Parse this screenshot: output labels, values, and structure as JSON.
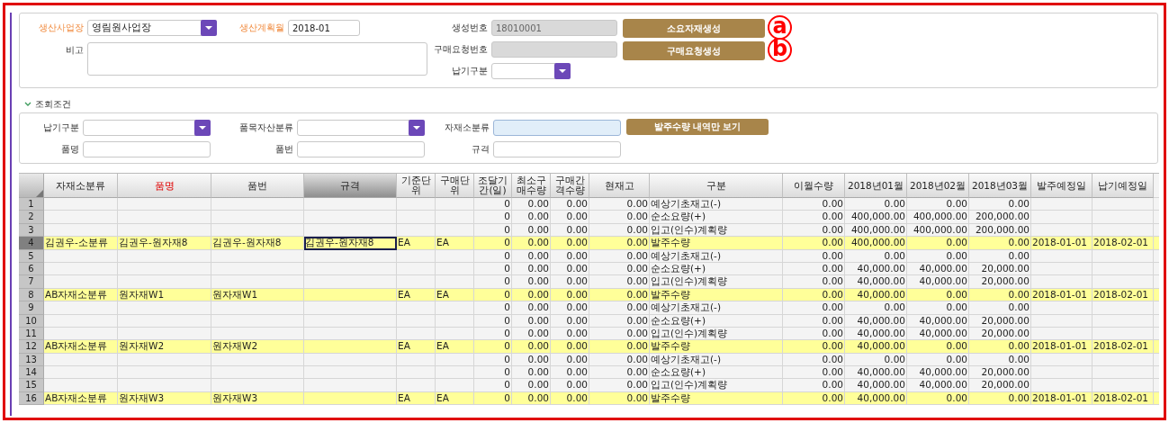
{
  "form": {
    "left_rows": [
      [
        {
          "label": "생산사업장",
          "required": true,
          "kind": "select",
          "value": "영림원사업장"
        },
        {
          "label": "생산계획월",
          "required": true,
          "kind": "text",
          "value": "2018-01"
        }
      ],
      [
        {
          "label": "비고",
          "required": false,
          "kind": "textarea"
        }
      ]
    ],
    "middle": [
      {
        "label": "생성번호",
        "kind": "text",
        "disabled": true,
        "value": "18010001"
      },
      {
        "label": "구매요청번호",
        "kind": "text",
        "disabled": true
      },
      {
        "label": "납기구분",
        "kind": "select"
      }
    ],
    "buttons": [
      {
        "label": "소요자재생성",
        "marker": "a"
      },
      {
        "label": "구매요청생성",
        "marker": "b"
      }
    ]
  },
  "search": {
    "title": "조회조건",
    "expanded": true,
    "fields": [
      {
        "label": "납기구분",
        "kind": "select",
        "active": false
      },
      {
        "label": "품목자산분류",
        "kind": "select",
        "active": false
      },
      {
        "label": "자재소분류",
        "kind": "text",
        "active": true
      },
      {
        "label": "품명",
        "kind": "text",
        "active": false
      },
      {
        "label": "품번",
        "kind": "text",
        "active": false
      },
      {
        "label": "규격",
        "kind": "text",
        "active": false
      }
    ],
    "button": "발주수량 내역만 보기"
  },
  "table": {
    "columns": [
      {
        "label": "자재소분류",
        "kind": "text",
        "required": false,
        "selected": false
      },
      {
        "label": "품명",
        "kind": "text",
        "required": true,
        "selected": false
      },
      {
        "label": "품번",
        "kind": "text",
        "required": false,
        "selected": false
      },
      {
        "label": "규격",
        "kind": "text",
        "required": false,
        "selected": true
      },
      {
        "label": "기준단위",
        "kind": "text",
        "required": false,
        "selected": false
      },
      {
        "label": "구매단위",
        "kind": "text",
        "required": false,
        "selected": false
      },
      {
        "label": "조달기간(일)",
        "kind": "number",
        "required": false,
        "selected": false
      },
      {
        "label": "최소구매수량",
        "kind": "number",
        "required": false,
        "selected": false
      },
      {
        "label": "구매간격수량",
        "kind": "number",
        "required": false,
        "selected": false
      },
      {
        "label": "현재고",
        "kind": "number",
        "required": false,
        "selected": false
      },
      {
        "label": "구분",
        "kind": "text",
        "required": false,
        "selected": false
      },
      {
        "label": "이월수량",
        "kind": "number",
        "required": false,
        "selected": false
      },
      {
        "label": "2018년01월",
        "kind": "number",
        "required": false,
        "selected": false
      },
      {
        "label": "2018년02월",
        "kind": "number",
        "required": false,
        "selected": false
      },
      {
        "label": "2018년03월",
        "kind": "number",
        "required": false,
        "selected": false
      },
      {
        "label": "발주예정일",
        "kind": "text",
        "required": false,
        "selected": false
      },
      {
        "label": "납기예정일",
        "kind": "text",
        "required": false,
        "selected": false
      }
    ],
    "rows": [
      {
        "number": "1",
        "kind": "plan",
        "selected": false,
        "cells": [
          null,
          null,
          null,
          null,
          null,
          null,
          "0",
          "0.00",
          "0.00",
          "0.00",
          "예상기초재고(-)",
          "0.00",
          "0.00",
          "0.00",
          "0.00",
          null,
          null
        ]
      },
      {
        "number": "2",
        "kind": "plan",
        "selected": false,
        "cells": [
          null,
          null,
          null,
          null,
          null,
          null,
          "0",
          "0.00",
          "0.00",
          "0.00",
          "순소요량(+)",
          "0.00",
          "400,000.00",
          "400,000.00",
          "200,000.00",
          null,
          null
        ]
      },
      {
        "number": "3",
        "kind": "plan",
        "selected": false,
        "cells": [
          null,
          null,
          null,
          null,
          null,
          null,
          "0",
          "0.00",
          "0.00",
          "0.00",
          "입고(인수)계획량",
          "0.00",
          "400,000.00",
          "400,000.00",
          "200,000.00",
          null,
          null
        ]
      },
      {
        "number": "4",
        "kind": "order",
        "selected": true,
        "cells": [
          "김권우-소분류",
          "김권우-원자재8",
          "김권우-원자재8",
          "김권우-원자재8",
          "EA",
          "EA",
          "0",
          "0.00",
          "0.00",
          "0.00",
          "발주수량",
          "0.00",
          "400,000.00",
          "0.00",
          "0.00",
          "2018-01-01",
          "2018-02-01"
        ]
      },
      {
        "number": "5",
        "kind": "plan",
        "selected": false,
        "cells": [
          null,
          null,
          null,
          null,
          null,
          null,
          "0",
          "0.00",
          "0.00",
          "0.00",
          "예상기초재고(-)",
          "0.00",
          "0.00",
          "0.00",
          "0.00",
          null,
          null
        ]
      },
      {
        "number": "6",
        "kind": "plan",
        "selected": false,
        "cells": [
          null,
          null,
          null,
          null,
          null,
          null,
          "0",
          "0.00",
          "0.00",
          "0.00",
          "순소요량(+)",
          "0.00",
          "40,000.00",
          "40,000.00",
          "20,000.00",
          null,
          null
        ]
      },
      {
        "number": "7",
        "kind": "plan",
        "selected": false,
        "cells": [
          null,
          null,
          null,
          null,
          null,
          null,
          "0",
          "0.00",
          "0.00",
          "0.00",
          "입고(인수)계획량",
          "0.00",
          "40,000.00",
          "40,000.00",
          "20,000.00",
          null,
          null
        ]
      },
      {
        "number": "8",
        "kind": "order",
        "selected": false,
        "cells": [
          "AB자재소분류",
          "원자재W1",
          "원자재W1",
          null,
          "EA",
          "EA",
          "0",
          "0.00",
          "0.00",
          "0.00",
          "발주수량",
          "0.00",
          "40,000.00",
          "0.00",
          "0.00",
          "2018-01-01",
          "2018-02-01"
        ]
      },
      {
        "number": "9",
        "kind": "plan",
        "selected": false,
        "cells": [
          null,
          null,
          null,
          null,
          null,
          null,
          "0",
          "0.00",
          "0.00",
          "0.00",
          "예상기초재고(-)",
          "0.00",
          "0.00",
          "0.00",
          "0.00",
          null,
          null
        ]
      },
      {
        "number": "10",
        "kind": "plan",
        "selected": false,
        "cells": [
          null,
          null,
          null,
          null,
          null,
          null,
          "0",
          "0.00",
          "0.00",
          "0.00",
          "순소요량(+)",
          "0.00",
          "40,000.00",
          "40,000.00",
          "20,000.00",
          null,
          null
        ]
      },
      {
        "number": "11",
        "kind": "plan",
        "selected": false,
        "cells": [
          null,
          null,
          null,
          null,
          null,
          null,
          "0",
          "0.00",
          "0.00",
          "0.00",
          "입고(인수)계획량",
          "0.00",
          "40,000.00",
          "40,000.00",
          "20,000.00",
          null,
          null
        ]
      },
      {
        "number": "12",
        "kind": "order",
        "selected": false,
        "cells": [
          "AB자재소분류",
          "원자재W2",
          "원자재W2",
          null,
          "EA",
          "EA",
          "0",
          "0.00",
          "0.00",
          "0.00",
          "발주수량",
          "0.00",
          "40,000.00",
          "0.00",
          "0.00",
          "2018-01-01",
          "2018-02-01"
        ]
      },
      {
        "number": "13",
        "kind": "plan",
        "selected": false,
        "cells": [
          null,
          null,
          null,
          null,
          null,
          null,
          "0",
          "0.00",
          "0.00",
          "0.00",
          "예상기초재고(-)",
          "0.00",
          "0.00",
          "0.00",
          "0.00",
          null,
          null
        ]
      },
      {
        "number": "14",
        "kind": "plan",
        "selected": false,
        "cells": [
          null,
          null,
          null,
          null,
          null,
          null,
          "0",
          "0.00",
          "0.00",
          "0.00",
          "순소요량(+)",
          "0.00",
          "40,000.00",
          "40,000.00",
          "20,000.00",
          null,
          null
        ]
      },
      {
        "number": "15",
        "kind": "plan",
        "selected": false,
        "cells": [
          null,
          null,
          null,
          null,
          null,
          null,
          "0",
          "0.00",
          "0.00",
          "0.00",
          "입고(인수)계획량",
          "0.00",
          "40,000.00",
          "40,000.00",
          "20,000.00",
          null,
          null
        ]
      },
      {
        "number": "16",
        "kind": "order",
        "selected": false,
        "cells": [
          "AB자재소분류",
          "원자재W3",
          "원자재W3",
          null,
          "EA",
          "EA",
          "0",
          "0.00",
          "0.00",
          "0.00",
          "발주수량",
          "0.00",
          "40,000.00",
          "0.00",
          "0.00",
          "2018-01-01",
          "2018-02-01"
        ]
      }
    ]
  }
}
